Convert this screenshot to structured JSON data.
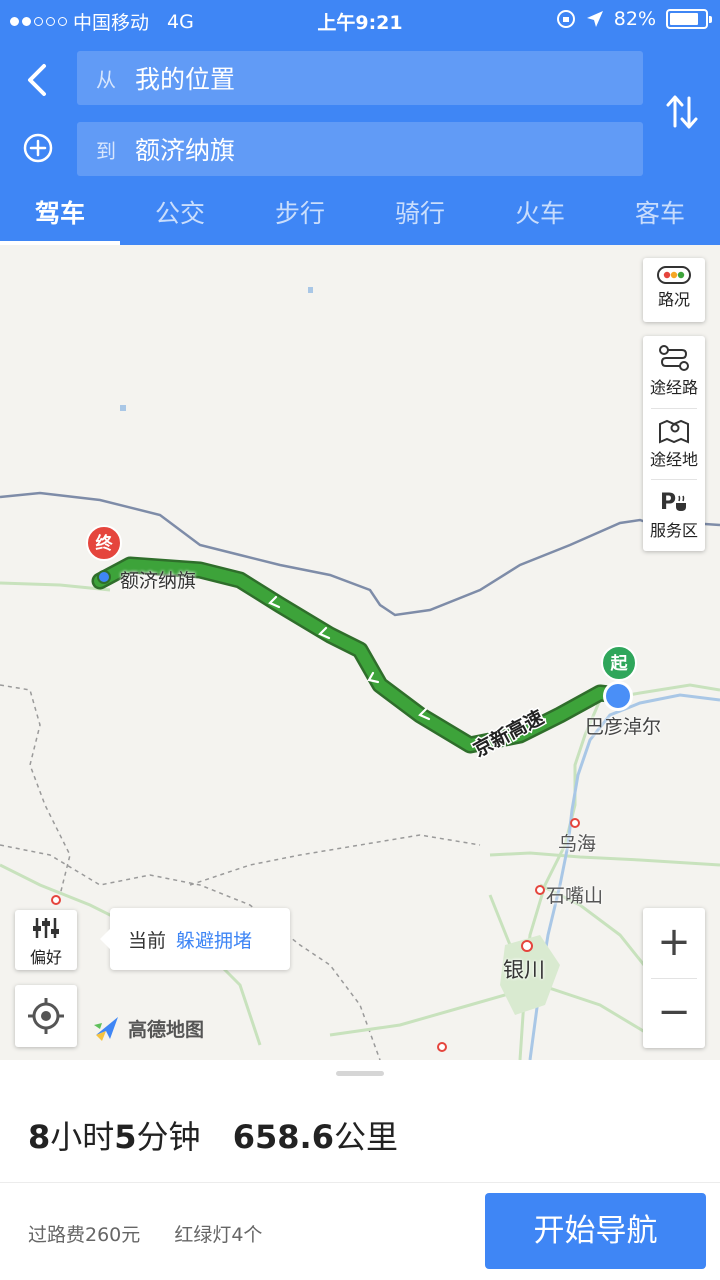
{
  "status_bar": {
    "carrier": "中国移动",
    "network": "4G",
    "time": "上午9:21",
    "battery_text": "82%",
    "battery_level": 0.82,
    "signal_bars": 2
  },
  "header": {
    "from_prefix": "从",
    "from_value": "我的位置",
    "to_prefix": "到",
    "to_value": "额济纳旗"
  },
  "tabs": [
    {
      "label": "驾车",
      "active": true
    },
    {
      "label": "公交",
      "active": false
    },
    {
      "label": "步行",
      "active": false
    },
    {
      "label": "骑行",
      "active": false
    },
    {
      "label": "火车",
      "active": false
    },
    {
      "label": "客车",
      "active": false
    }
  ],
  "map": {
    "end_marker": "终",
    "start_marker": "起",
    "destination_label": "额济纳旗",
    "origin_label": "巴彦淖尔",
    "road_label": "京新高速",
    "city_labels": [
      "乌海",
      "石嘴山",
      "银川"
    ],
    "controls": {
      "traffic": "路况",
      "via_route": "途经路",
      "via_place": "途经地",
      "service_area": "服务区"
    },
    "preference": {
      "button_label": "偏好",
      "tip_prefix": "当前",
      "tip_value": "躲避拥堵"
    },
    "logo_text": "高德地图",
    "zoom_in": "+",
    "zoom_out": "−",
    "route_color": "#3da33a",
    "accent": "#3f86f5"
  },
  "route_summary": {
    "hours": "8",
    "hours_unit": "小时",
    "minutes": "5",
    "minutes_unit": "分钟",
    "distance": "658.6",
    "distance_unit": "公里",
    "toll": "过路费260元",
    "traffic_lights": "红绿灯4个",
    "start_button": "开始导航"
  }
}
